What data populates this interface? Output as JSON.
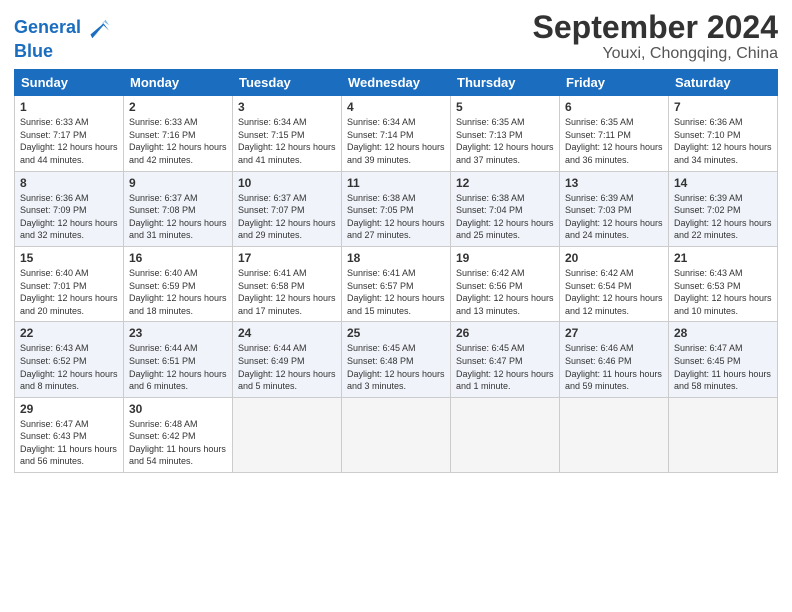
{
  "header": {
    "logo_line1": "General",
    "logo_line2": "Blue",
    "title": "September 2024",
    "subtitle": "Youxi, Chongqing, China"
  },
  "weekdays": [
    "Sunday",
    "Monday",
    "Tuesday",
    "Wednesday",
    "Thursday",
    "Friday",
    "Saturday"
  ],
  "weeks": [
    [
      {
        "day": 1,
        "sunrise": "6:33 AM",
        "sunset": "7:17 PM",
        "daylight": "12 hours and 44 minutes."
      },
      {
        "day": 2,
        "sunrise": "6:33 AM",
        "sunset": "7:16 PM",
        "daylight": "12 hours and 42 minutes."
      },
      {
        "day": 3,
        "sunrise": "6:34 AM",
        "sunset": "7:15 PM",
        "daylight": "12 hours and 41 minutes."
      },
      {
        "day": 4,
        "sunrise": "6:34 AM",
        "sunset": "7:14 PM",
        "daylight": "12 hours and 39 minutes."
      },
      {
        "day": 5,
        "sunrise": "6:35 AM",
        "sunset": "7:13 PM",
        "daylight": "12 hours and 37 minutes."
      },
      {
        "day": 6,
        "sunrise": "6:35 AM",
        "sunset": "7:11 PM",
        "daylight": "12 hours and 36 minutes."
      },
      {
        "day": 7,
        "sunrise": "6:36 AM",
        "sunset": "7:10 PM",
        "daylight": "12 hours and 34 minutes."
      }
    ],
    [
      {
        "day": 8,
        "sunrise": "6:36 AM",
        "sunset": "7:09 PM",
        "daylight": "12 hours and 32 minutes."
      },
      {
        "day": 9,
        "sunrise": "6:37 AM",
        "sunset": "7:08 PM",
        "daylight": "12 hours and 31 minutes."
      },
      {
        "day": 10,
        "sunrise": "6:37 AM",
        "sunset": "7:07 PM",
        "daylight": "12 hours and 29 minutes."
      },
      {
        "day": 11,
        "sunrise": "6:38 AM",
        "sunset": "7:05 PM",
        "daylight": "12 hours and 27 minutes."
      },
      {
        "day": 12,
        "sunrise": "6:38 AM",
        "sunset": "7:04 PM",
        "daylight": "12 hours and 25 minutes."
      },
      {
        "day": 13,
        "sunrise": "6:39 AM",
        "sunset": "7:03 PM",
        "daylight": "12 hours and 24 minutes."
      },
      {
        "day": 14,
        "sunrise": "6:39 AM",
        "sunset": "7:02 PM",
        "daylight": "12 hours and 22 minutes."
      }
    ],
    [
      {
        "day": 15,
        "sunrise": "6:40 AM",
        "sunset": "7:01 PM",
        "daylight": "12 hours and 20 minutes."
      },
      {
        "day": 16,
        "sunrise": "6:40 AM",
        "sunset": "6:59 PM",
        "daylight": "12 hours and 18 minutes."
      },
      {
        "day": 17,
        "sunrise": "6:41 AM",
        "sunset": "6:58 PM",
        "daylight": "12 hours and 17 minutes."
      },
      {
        "day": 18,
        "sunrise": "6:41 AM",
        "sunset": "6:57 PM",
        "daylight": "12 hours and 15 minutes."
      },
      {
        "day": 19,
        "sunrise": "6:42 AM",
        "sunset": "6:56 PM",
        "daylight": "12 hours and 13 minutes."
      },
      {
        "day": 20,
        "sunrise": "6:42 AM",
        "sunset": "6:54 PM",
        "daylight": "12 hours and 12 minutes."
      },
      {
        "day": 21,
        "sunrise": "6:43 AM",
        "sunset": "6:53 PM",
        "daylight": "12 hours and 10 minutes."
      }
    ],
    [
      {
        "day": 22,
        "sunrise": "6:43 AM",
        "sunset": "6:52 PM",
        "daylight": "12 hours and 8 minutes."
      },
      {
        "day": 23,
        "sunrise": "6:44 AM",
        "sunset": "6:51 PM",
        "daylight": "12 hours and 6 minutes."
      },
      {
        "day": 24,
        "sunrise": "6:44 AM",
        "sunset": "6:49 PM",
        "daylight": "12 hours and 5 minutes."
      },
      {
        "day": 25,
        "sunrise": "6:45 AM",
        "sunset": "6:48 PM",
        "daylight": "12 hours and 3 minutes."
      },
      {
        "day": 26,
        "sunrise": "6:45 AM",
        "sunset": "6:47 PM",
        "daylight": "12 hours and 1 minute."
      },
      {
        "day": 27,
        "sunrise": "6:46 AM",
        "sunset": "6:46 PM",
        "daylight": "11 hours and 59 minutes."
      },
      {
        "day": 28,
        "sunrise": "6:47 AM",
        "sunset": "6:45 PM",
        "daylight": "11 hours and 58 minutes."
      }
    ],
    [
      {
        "day": 29,
        "sunrise": "6:47 AM",
        "sunset": "6:43 PM",
        "daylight": "11 hours and 56 minutes."
      },
      {
        "day": 30,
        "sunrise": "6:48 AM",
        "sunset": "6:42 PM",
        "daylight": "11 hours and 54 minutes."
      },
      null,
      null,
      null,
      null,
      null
    ]
  ]
}
